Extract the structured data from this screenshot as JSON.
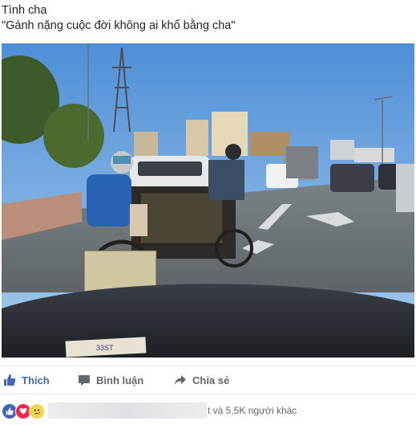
{
  "post": {
    "line1": "Tình cha",
    "line2": "\"Gánh nặng cuộc đời không ai khổ bằng cha\""
  },
  "photo": {
    "sign_text": "33ST"
  },
  "actions": {
    "like_label": "Thích",
    "comment_label": "Bình luận",
    "share_label": "Chia sẻ"
  },
  "reactions": {
    "icons": [
      "like-reaction",
      "love-reaction",
      "sad-reaction"
    ],
    "count_text": "t và 5,5K người khác"
  },
  "colors": {
    "facebook_blue": "#4267b2",
    "love_red": "#f0284a",
    "sad_yellow": "#f7d44a"
  }
}
